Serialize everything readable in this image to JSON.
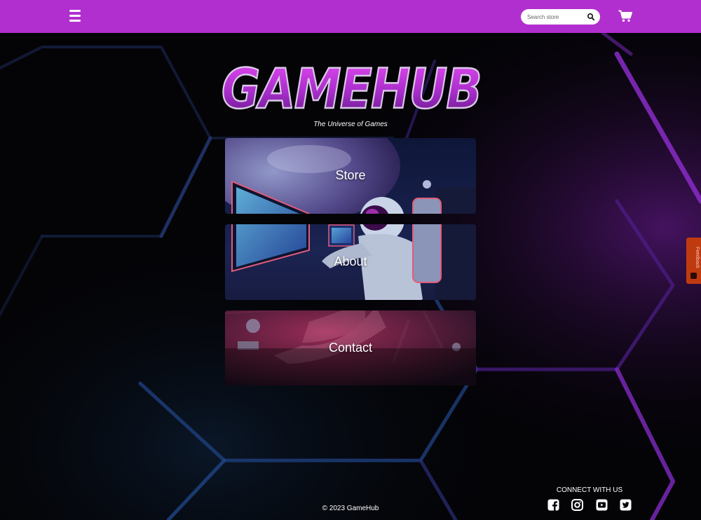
{
  "header": {
    "search_placeholder": "Search store",
    "icons": [
      "hamburger-menu-icon",
      "search-icon",
      "shopping-cart-icon"
    ],
    "accent_color": "#b22fcf"
  },
  "hero": {
    "logo_text": "GAMEHUB",
    "tagline": "The Universe of Games"
  },
  "cards": [
    {
      "label": "Store"
    },
    {
      "label": "About"
    },
    {
      "label": "Contact"
    }
  ],
  "feedback": {
    "label": "Feedback",
    "color": "#c03a10"
  },
  "footer": {
    "copyright": "© 2023 GameHub",
    "connect_label": "CONNECT WITH US",
    "social_icons": [
      "facebook-icon",
      "instagram-icon",
      "youtube-icon",
      "twitter-icon"
    ]
  }
}
